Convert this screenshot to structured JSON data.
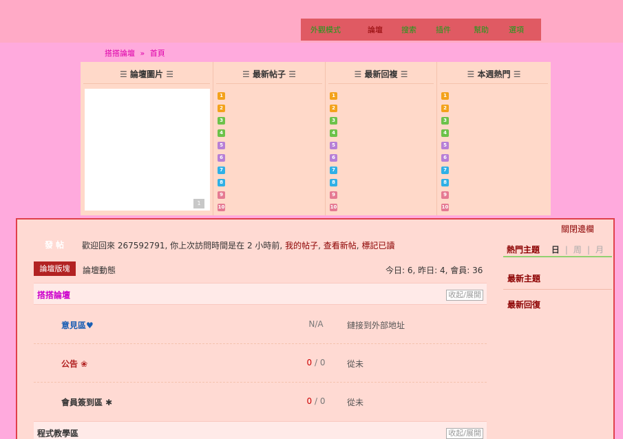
{
  "nav": {
    "items": [
      "外觀模式",
      "論壇",
      "搜索",
      "插件",
      "幫助",
      "選項"
    ]
  },
  "breadcrumb": {
    "home": "搭搭論壇",
    "sep": "»",
    "current": "首頁"
  },
  "portal": {
    "columns": [
      {
        "title": "論壇圖片"
      },
      {
        "title": "最新帖子"
      },
      {
        "title": "最新回複"
      },
      {
        "title": "本週熱門"
      }
    ],
    "deco": "☰",
    "rank_numbers": [
      "1",
      "2",
      "3",
      "4",
      "5",
      "6",
      "7",
      "8",
      "9",
      "10"
    ],
    "rank_colors": [
      "#f3a21b",
      "#f3a21b",
      "#6cc24a",
      "#6cc24a",
      "#b77fd6",
      "#b77fd6",
      "#2fb0e6",
      "#2fb0e6",
      "#e57a92",
      "#e57a92"
    ]
  },
  "post_button": "發帖",
  "welcome": {
    "prefix": "歡迎回來 267592791, 你上次訪問時間是在 2 小時前, ",
    "my_posts": "我的帖子",
    "comma1": ", ",
    "new_posts": "查看新帖",
    "comma2": ", ",
    "mark_read": "標記已讀"
  },
  "tabs": {
    "active": "論壇版塊",
    "second": "論壇動態"
  },
  "stats": "今日: 6, 昨日: 4, 會員: 36",
  "categories": [
    {
      "title": "搭搭論壇",
      "color": "#cc00cc",
      "toggle": "收起/展開"
    },
    {
      "title": "程式教學區",
      "color": "#333333",
      "toggle": "收起/展開"
    }
  ],
  "forums": [
    {
      "name": "意見區♥",
      "color": "#1a5fb4",
      "count": "N/A",
      "count_red": "",
      "count_rest": "",
      "last": "鏈接到外部地址"
    },
    {
      "name": "公告 ❀",
      "color": "#b22222",
      "count": "",
      "count_red": "0",
      "count_rest": " / 0",
      "last": "從未"
    },
    {
      "name": "會員簽到區 ✱",
      "color": "#333333",
      "count": "",
      "count_red": "0",
      "count_rest": " / 0",
      "last": "從未"
    }
  ],
  "sidebar": {
    "close": "關閉邊欄",
    "hot_title": "熱門主題",
    "periods": [
      "日",
      "周",
      "月"
    ],
    "divider": "|",
    "latest_topics": "最新主題",
    "latest_replies": "最新回復"
  }
}
